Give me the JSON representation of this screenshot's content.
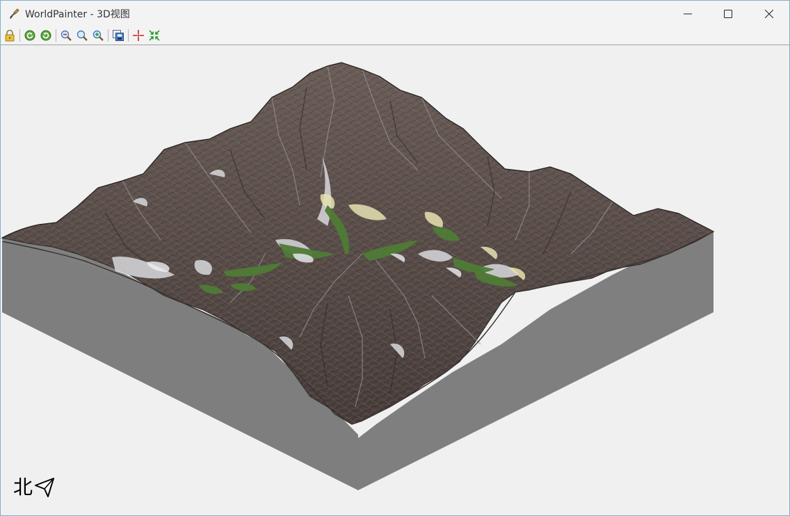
{
  "window": {
    "app_name": "WorldPainter",
    "title": "WorldPainter - 3D视图",
    "controls": {
      "minimize": "minimize-icon",
      "maximize": "maximize-icon",
      "close": "close-icon"
    }
  },
  "toolbar": {
    "buttons": [
      {
        "name": "lock-icon"
      },
      {
        "name": "rotate-left-icon"
      },
      {
        "name": "rotate-right-icon"
      },
      {
        "name": "zoom-out-icon"
      },
      {
        "name": "zoom-reset-icon"
      },
      {
        "name": "zoom-in-icon"
      },
      {
        "name": "export-image-icon"
      },
      {
        "name": "move-to-spawn-icon"
      },
      {
        "name": "move-to-origin-icon"
      }
    ]
  },
  "viewport": {
    "compass_label": "北",
    "colors": {
      "terrain_rock": "#5f5653",
      "terrain_dark": "#3f3836",
      "snow": "#d8d8dc",
      "grass": "#4f7c35",
      "sand": "#e6e2b0",
      "side_wall": "#808080",
      "background": "#f0f0f0"
    }
  }
}
